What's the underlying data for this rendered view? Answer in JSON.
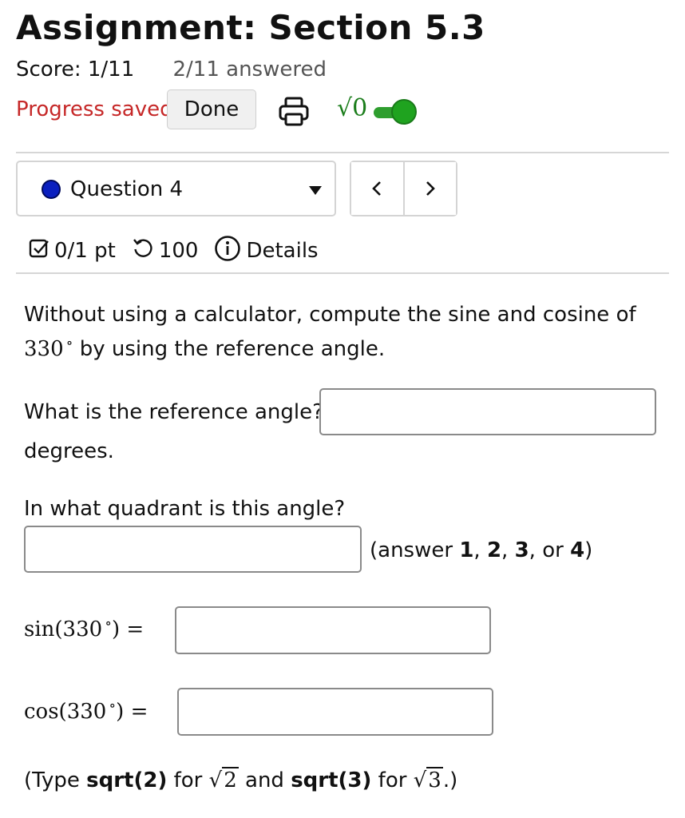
{
  "header": {
    "title": "Assignment: Section 5.3",
    "score": "Score: 1/11",
    "answered": "2/11 answered",
    "progress_status": "Progress saved",
    "done_label": "Done",
    "math_toggle_glyph": "√0",
    "math_toggle_on": true,
    "accent_color": "#c62828",
    "toggle_color": "#1fa31f"
  },
  "question_nav": {
    "selected": "Question 4",
    "status_dot_color": "#0a1fbf",
    "prev_label": "<",
    "next_label": ">"
  },
  "meta": {
    "points": "0/1 pt",
    "retries": "100",
    "details": "Details"
  },
  "question": {
    "prompt": "Without using a calculator, compute the sine and cosine of",
    "angle": "330",
    "prompt_tail": "by using the reference angle.",
    "reference_label": "What is the reference angle?",
    "reference_value": "",
    "reference_unit": "degrees.",
    "quadrant_label": "In what quadrant is this angle?",
    "quadrant_value": "",
    "quadrant_hint_prefix": "(answer ",
    "quadrant_hint_1": "1",
    "quadrant_hint_2": "2",
    "quadrant_hint_3": "3",
    "quadrant_hint_or": "or",
    "quadrant_hint_4": "4",
    "quadrant_hint_suffix": ")",
    "sin_label_fn": "sin(330",
    "cos_label_fn": "cos(330",
    "deg_symbol": "∘",
    "close_eq": ") =",
    "sin_value": "",
    "cos_value": "",
    "hint_type": "(Type ",
    "hint_sqrt2_code": "sqrt(2)",
    "hint_for_1": " for ",
    "hint_sqrt2_radicand": "2",
    "hint_and": " and ",
    "hint_sqrt3_code": "sqrt(3)",
    "hint_for_2": " for ",
    "hint_sqrt3_radicand": "3",
    "hint_end": ".)"
  }
}
